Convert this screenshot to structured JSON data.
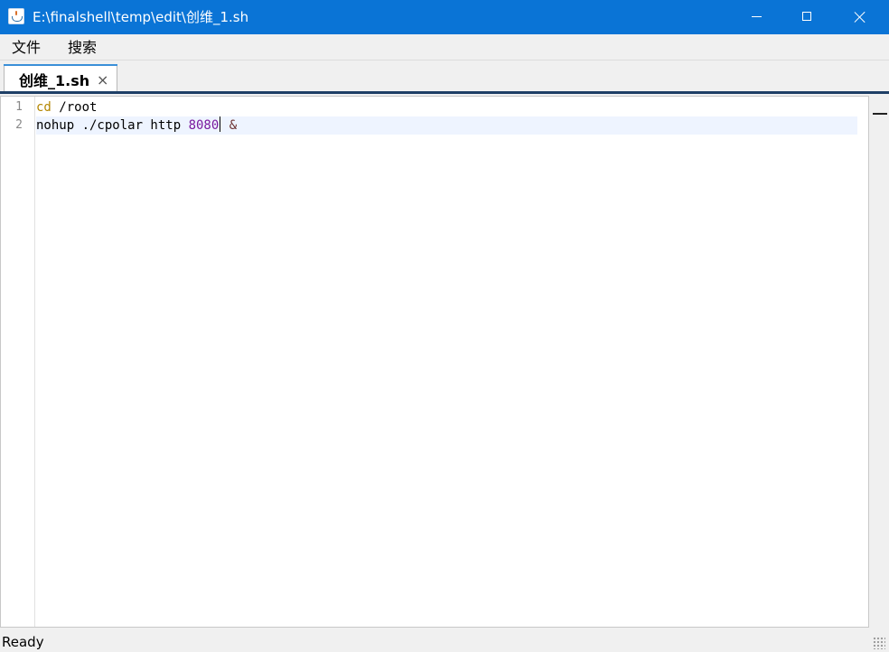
{
  "window": {
    "title": "E:\\finalshell\\temp\\edit\\创维_1.sh"
  },
  "menu": {
    "items": [
      {
        "label": "文件"
      },
      {
        "label": "搜索"
      }
    ]
  },
  "tabs": [
    {
      "label": "创维_1.sh",
      "close": "×"
    }
  ],
  "editor": {
    "line_numbers": [
      "1",
      "2"
    ],
    "lines": [
      {
        "keyword": "cd",
        "rest": " /root"
      },
      {
        "command": "nohup ./cpolar http ",
        "number": "8080",
        "operator": " &"
      }
    ]
  },
  "status": {
    "text": "Ready"
  },
  "colors": {
    "titlebar": "#0a74d6",
    "keyword": "#b38600",
    "number": "#7a1a9e",
    "current_line": "#eef4ff"
  }
}
